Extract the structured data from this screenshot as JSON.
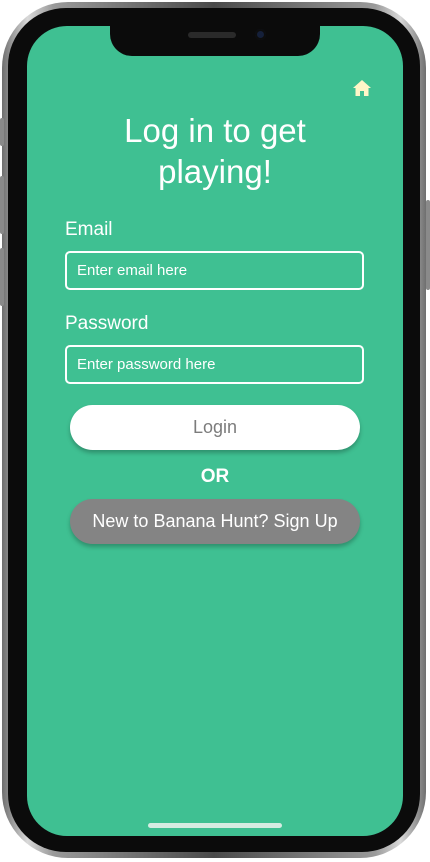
{
  "header": {
    "home_icon": "home-icon",
    "title": "Log in to get playing!"
  },
  "form": {
    "email_label": "Email",
    "email_placeholder": "Enter email here",
    "email_value": "",
    "password_label": "Password",
    "password_placeholder": "Enter password here",
    "password_value": "",
    "login_label": "Login",
    "or_text": "OR",
    "signup_label": "New to Banana Hunt? Sign Up"
  },
  "colors": {
    "background": "#3fc092",
    "login_button": "#ffffff",
    "signup_button": "#848484",
    "home_icon": "#fff6c8"
  }
}
